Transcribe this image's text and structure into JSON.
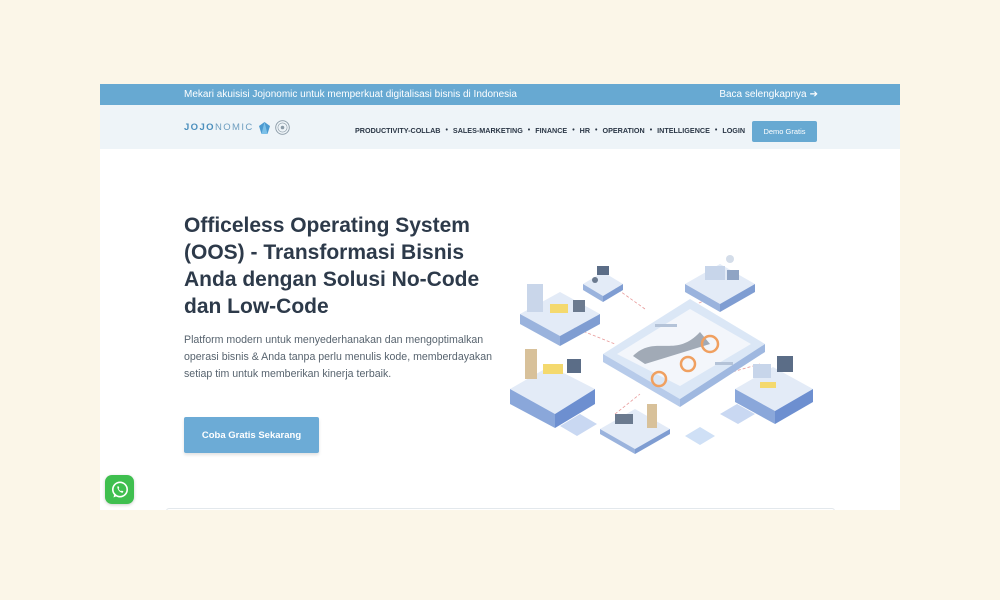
{
  "announcement": {
    "text": "Mekari akuisisi Jojonomic untuk memperkuat digitalisasi bisnis di Indonesia",
    "link_label": "Baca selengkapnya",
    "arrow_icon": "arrow-right-icon"
  },
  "header": {
    "logo_bold": "JOJO",
    "logo_light": "NOMIC",
    "nav": [
      "PRODUCTIVITY-COLLAB",
      "SALES-MARKETING",
      "FINANCE",
      "HR",
      "OPERATION",
      "INTELLIGENCE",
      "LOGIN"
    ],
    "demo_label": "Demo Gratis"
  },
  "hero": {
    "title": "Officeless Operating System (OOS) - Transformasi Bisnis Anda dengan Solusi No-Code dan Low-Code",
    "subtitle": "Platform modern untuk menyederhanakan dan mengoptimalkan operasi bisnis & Anda tanpa perlu menulis kode, memberdayakan setiap tim untuk memberikan kinerja terbaik.",
    "cta_label": "Coba Gratis Sekarang",
    "illustration_icon": "isometric-office-illustration"
  },
  "whatsapp": {
    "icon": "whatsapp-icon"
  },
  "colors": {
    "accent": "#67a9d2",
    "page_bg": "#fbf6e8",
    "header_bg": "#eef4f8",
    "title": "#2d3a4a",
    "whatsapp": "#3fbf4f"
  }
}
